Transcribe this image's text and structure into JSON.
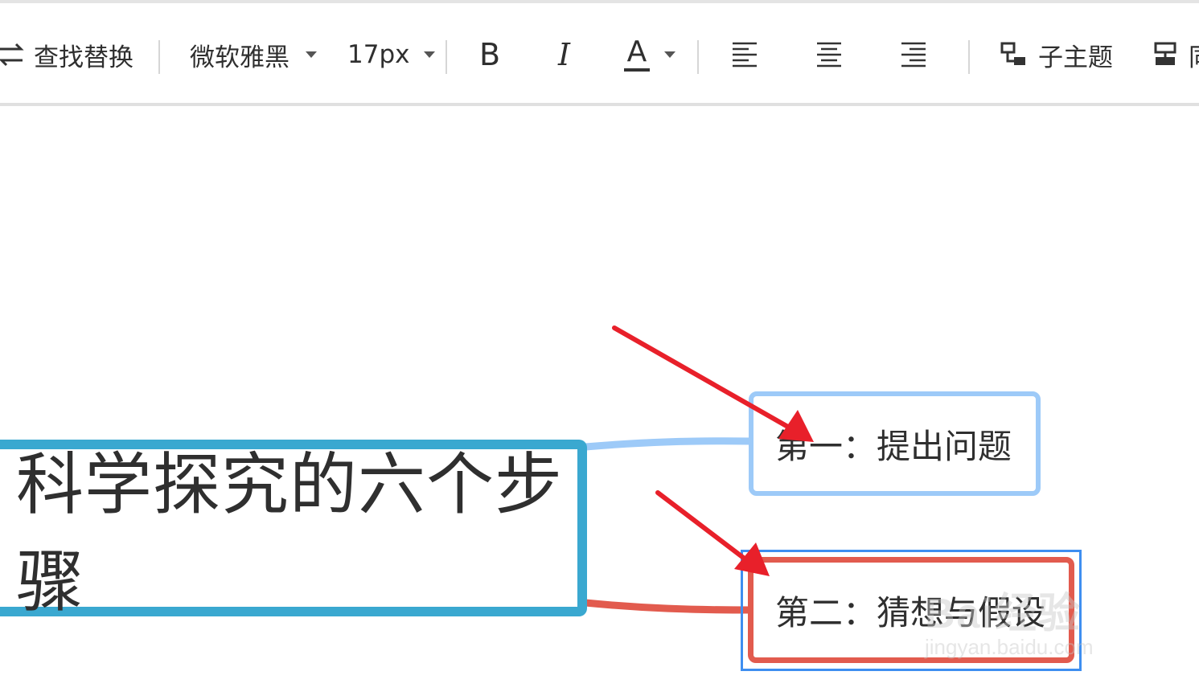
{
  "toolbar": {
    "find_replace_label": "查找替换",
    "font_family": "微软雅黑",
    "font_size": "17px",
    "bold_label": "B",
    "italic_label": "I",
    "font_color_label": "A",
    "subtopic_label": "子主题",
    "clipped_label": "同"
  },
  "mindmap": {
    "root": {
      "text": "科学探究的六个步骤",
      "border_color": "#3aa8d0"
    },
    "children": [
      {
        "text": "第一：提出问题",
        "border_color": "#9dcaf8",
        "selected": false
      },
      {
        "text": "第二：猜想与假设",
        "border_color": "#e25b4e",
        "selected": true
      }
    ]
  },
  "annotation": {
    "arrow_color": "#e8202a",
    "count": 2
  },
  "colors": {
    "selection": "#3e8ef0",
    "accent_blue": "#3aa8d0",
    "accent_red": "#e25b4e"
  },
  "watermark": {
    "main": "Bai经验",
    "sub": "jingyan.baidu.com"
  }
}
